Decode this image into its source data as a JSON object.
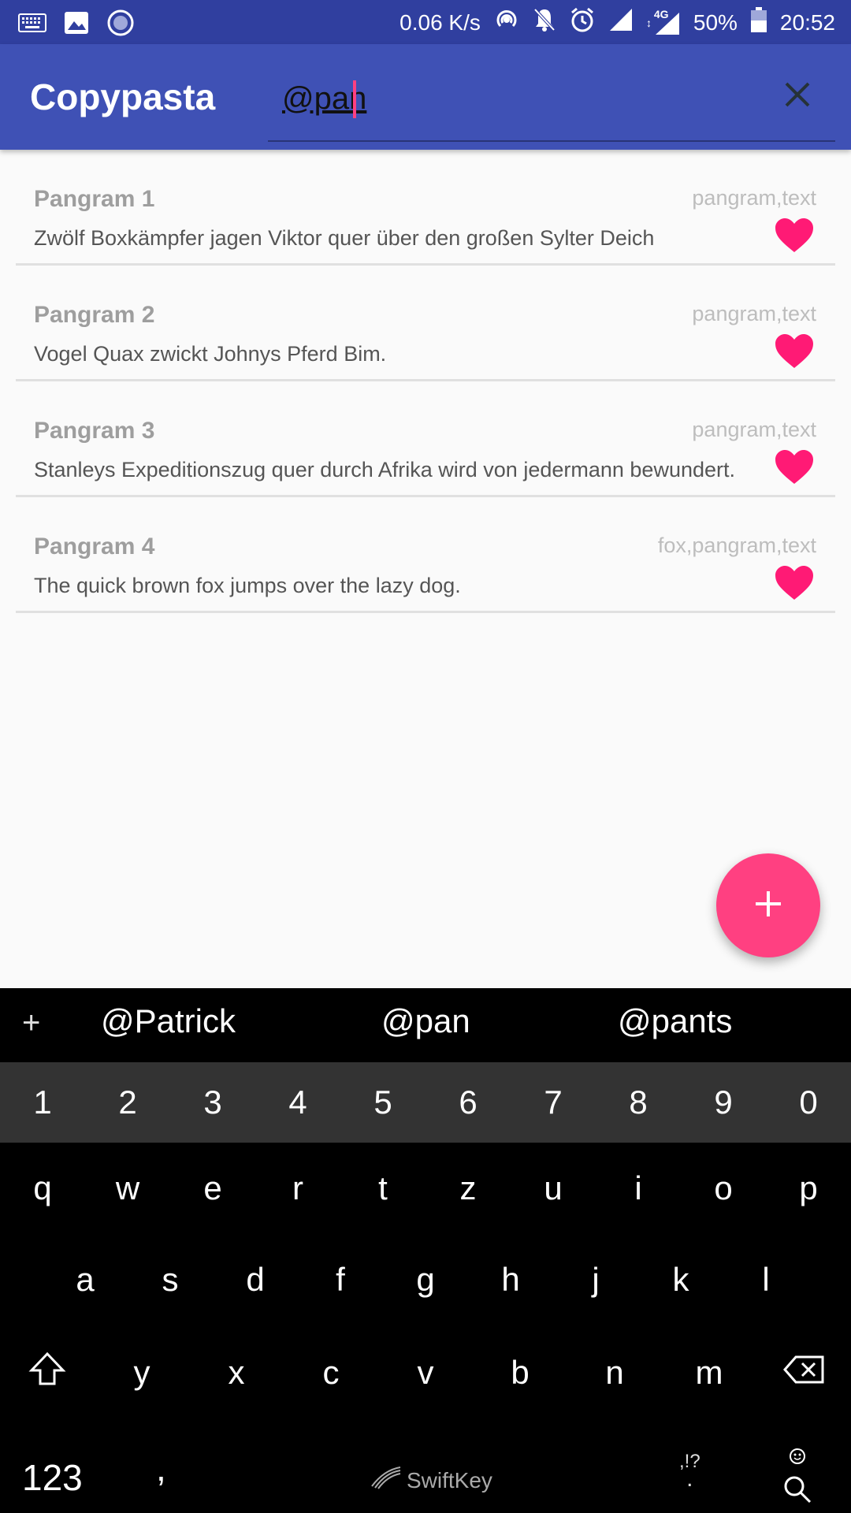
{
  "status_bar": {
    "speed": "0.06 K/s",
    "network": "4G",
    "battery": "50%",
    "time": "20:52",
    "icons_left": [
      "keyboard-icon",
      "image-icon",
      "circle-icon"
    ],
    "icons_right": [
      "hotspot-icon",
      "bell-off-icon",
      "alarm-icon",
      "signal-icon",
      "signal-4g-icon",
      "battery-icon"
    ]
  },
  "app_bar": {
    "title": "Copypasta",
    "search_value": "@pan",
    "close_icon": "close-icon"
  },
  "items": [
    {
      "title": "Pangram 1",
      "tags": "pangram,text",
      "text": "Zwölf Boxkämpfer jagen Viktor quer über den großen Sylter Deich",
      "favorite_icon": "heart-icon"
    },
    {
      "title": "Pangram 2",
      "tags": "pangram,text",
      "text": "Vogel Quax zwickt Johnys Pferd Bim.",
      "favorite_icon": "heart-icon"
    },
    {
      "title": "Pangram 3",
      "tags": "pangram,text",
      "text": "Stanleys Expeditionszug quer durch Afrika wird von jedermann bewundert.",
      "favorite_icon": "heart-icon"
    },
    {
      "title": "Pangram 4",
      "tags": "fox,pangram,text",
      "text": "The quick brown fox jumps over the lazy dog.",
      "favorite_icon": "heart-icon"
    }
  ],
  "fab": {
    "icon": "plus-icon"
  },
  "keyboard": {
    "suggestions": [
      "@Patrick",
      "@pan",
      "@pants"
    ],
    "suggestion_plus": "+",
    "numbers": [
      "1",
      "2",
      "3",
      "4",
      "5",
      "6",
      "7",
      "8",
      "9",
      "0"
    ],
    "row1": [
      "q",
      "w",
      "e",
      "r",
      "t",
      "z",
      "u",
      "i",
      "o",
      "p"
    ],
    "row2": [
      "a",
      "s",
      "d",
      "f",
      "g",
      "h",
      "j",
      "k",
      "l"
    ],
    "row3": [
      "y",
      "x",
      "c",
      "v",
      "b",
      "n",
      "m"
    ],
    "mode_key": "123",
    "comma": ",",
    "brand": "SwiftKey",
    "punct_label": ",!?",
    "period": "."
  },
  "colors": {
    "status_bar": "#303f9f",
    "app_bar": "#3f51b5",
    "accent": "#ff4081"
  }
}
